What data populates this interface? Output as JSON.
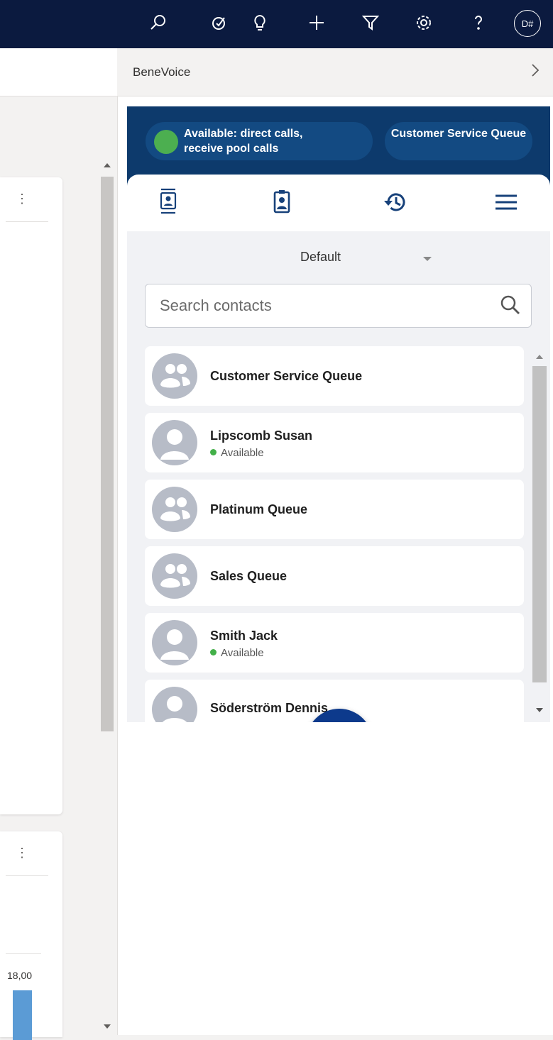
{
  "topbar": {
    "avatar_initials": "D#",
    "icons": [
      "search-icon",
      "target-icon",
      "lightbulb-icon",
      "plus-icon",
      "filter-icon",
      "settings-icon",
      "help-icon"
    ]
  },
  "left": {
    "chart_value": "18,00",
    "kebab": "⋮"
  },
  "panel": {
    "title": "BeneVoice",
    "collapse": "›"
  },
  "widget": {
    "status_text": "Available: direct calls, receive pool calls",
    "status_color": "#4caf50",
    "queue_label": "Customer Service Queue",
    "dropdown_value": "Default",
    "search_placeholder": "Search contacts",
    "contacts": [
      {
        "name": "Customer Service Queue",
        "type": "queue",
        "status": ""
      },
      {
        "name": "Lipscomb Susan",
        "type": "person",
        "status": "Available"
      },
      {
        "name": "Platinum Queue",
        "type": "queue",
        "status": ""
      },
      {
        "name": "Sales Queue",
        "type": "queue",
        "status": ""
      },
      {
        "name": "Smith Jack",
        "type": "person",
        "status": "Available"
      },
      {
        "name": "Söderström Dennis",
        "type": "person",
        "status": ""
      }
    ]
  },
  "colors": {
    "topbar": "#0b1a3f",
    "widget_header": "#0d3a6c",
    "dialpad": "#0d3a8c",
    "available": "#43b049"
  }
}
